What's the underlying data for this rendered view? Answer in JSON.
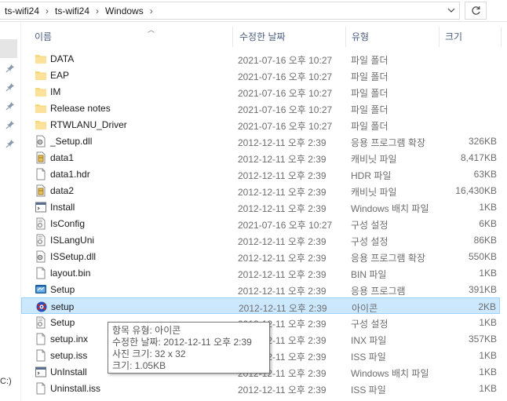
{
  "address": {
    "crumbs": [
      "ts-wifi24",
      "ts-wifi24",
      "Windows"
    ],
    "separator": "›",
    "dropdown_icon": "chevron-down-icon",
    "refresh_icon": "refresh-icon"
  },
  "nav": {
    "bottom_label": "C:)"
  },
  "columns": {
    "name": "이름",
    "date": "수정한 날짜",
    "type": "유형",
    "size": "크기"
  },
  "files": [
    {
      "name": "DATA",
      "date": "2021-07-16 오후 10:27",
      "type": "파일 폴더",
      "size": "",
      "icon": "folder"
    },
    {
      "name": "EAP",
      "date": "2021-07-16 오후 10:27",
      "type": "파일 폴더",
      "size": "",
      "icon": "folder"
    },
    {
      "name": "IM",
      "date": "2021-07-16 오후 10:27",
      "type": "파일 폴더",
      "size": "",
      "icon": "folder"
    },
    {
      "name": "Release notes",
      "date": "2021-07-16 오후 10:27",
      "type": "파일 폴더",
      "size": "",
      "icon": "folder"
    },
    {
      "name": "RTWLANU_Driver",
      "date": "2021-07-16 오후 10:27",
      "type": "파일 폴더",
      "size": "",
      "icon": "folder"
    },
    {
      "name": "_Setup.dll",
      "date": "2012-12-11 오후 2:39",
      "type": "응용 프로그램 확장",
      "size": "326KB",
      "icon": "dll"
    },
    {
      "name": "data1",
      "date": "2012-12-11 오후 2:39",
      "type": "캐비닛 파일",
      "size": "8,417KB",
      "icon": "cab"
    },
    {
      "name": "data1.hdr",
      "date": "2012-12-11 오후 2:39",
      "type": "HDR 파일",
      "size": "63KB",
      "icon": "doc"
    },
    {
      "name": "data2",
      "date": "2012-12-11 오후 2:39",
      "type": "캐비닛 파일",
      "size": "16,430KB",
      "icon": "cab"
    },
    {
      "name": "Install",
      "date": "2012-12-11 오후 2:39",
      "type": "Windows 배치 파일",
      "size": "1KB",
      "icon": "bat"
    },
    {
      "name": "IsConfig",
      "date": "2021-07-16 오후 10:27",
      "type": "구성 설정",
      "size": "6KB",
      "icon": "ini"
    },
    {
      "name": "ISLangUni",
      "date": "2012-12-11 오후 2:39",
      "type": "구성 설정",
      "size": "86KB",
      "icon": "ini"
    },
    {
      "name": "ISSetup.dll",
      "date": "2012-12-11 오후 2:39",
      "type": "응용 프로그램 확장",
      "size": "550KB",
      "icon": "dll"
    },
    {
      "name": "layout.bin",
      "date": "2012-12-11 오후 2:39",
      "type": "BIN 파일",
      "size": "1KB",
      "icon": "doc"
    },
    {
      "name": "Setup",
      "date": "2012-12-11 오후 2:39",
      "type": "응용 프로그램",
      "size": "391KB",
      "icon": "exe"
    },
    {
      "name": "setup",
      "date": "2012-12-11 오후 2:39",
      "type": "아이콘",
      "size": "2KB",
      "icon": "ico",
      "selected": true
    },
    {
      "name": "Setup",
      "date": "2012-12-11 오후 2:39",
      "type": "구성 설정",
      "size": "1KB",
      "icon": "ini"
    },
    {
      "name": "setup.inx",
      "date": "2012-12-11 오후 2:39",
      "type": "INX 파일",
      "size": "357KB",
      "icon": "doc"
    },
    {
      "name": "setup.iss",
      "date": "2012-12-11 오후 2:39",
      "type": "ISS 파일",
      "size": "1KB",
      "icon": "doc"
    },
    {
      "name": "UnInstall",
      "date": "2012-12-11 오후 2:39",
      "type": "Windows 배치 파일",
      "size": "1KB",
      "icon": "bat"
    },
    {
      "name": "Uninstall.iss",
      "date": "2012-12-11 오후 2:39",
      "type": "ISS 파일",
      "size": "1KB",
      "icon": "doc"
    }
  ],
  "tooltip": {
    "line1": "항목 유형: 아이콘",
    "line2": "수정한 날짜: 2012-12-11 오후 2:39",
    "line3": "사진 크기: 32 x 32",
    "line4": "크기: 1.05KB"
  },
  "colors": {
    "folder": "#f8d775",
    "selected_bg": "#cce8ff",
    "selected_border": "#99d1ff",
    "header_text": "#4d6082",
    "meta_text": "#6d6d6d"
  }
}
